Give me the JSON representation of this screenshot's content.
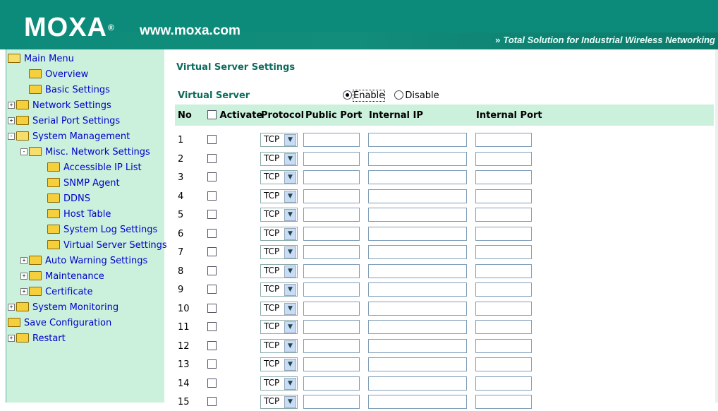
{
  "header": {
    "logo_text": "MOXA",
    "logo_reg": "®",
    "logo_url": "www.moxa.com",
    "tagline_arrow": "»",
    "tagline": "Total Solution for Industrial Wireless Networking",
    "color": "#0d8b7a"
  },
  "sidebar": {
    "items": [
      {
        "label": "Main Menu",
        "expander": "",
        "depth": 0,
        "open": true
      },
      {
        "label": "Overview",
        "expander": "",
        "depth": 1
      },
      {
        "label": "Basic Settings",
        "expander": "",
        "depth": 1
      },
      {
        "label": "Network Settings",
        "expander": "+",
        "depth": 0
      },
      {
        "label": "Serial Port Settings",
        "expander": "+",
        "depth": 0
      },
      {
        "label": "System Management",
        "expander": "-",
        "depth": 0,
        "open": true
      },
      {
        "label": "Misc. Network Settings",
        "expander": "-",
        "depth": 1,
        "open": true
      },
      {
        "label": "Accessible IP List",
        "expander": "",
        "depth": 2
      },
      {
        "label": "SNMP Agent",
        "expander": "",
        "depth": 2
      },
      {
        "label": "DDNS",
        "expander": "",
        "depth": 2
      },
      {
        "label": "Host Table",
        "expander": "",
        "depth": 2
      },
      {
        "label": "System Log Settings",
        "expander": "",
        "depth": 2
      },
      {
        "label": "Virtual Server Settings",
        "expander": "",
        "depth": 2
      },
      {
        "label": "Auto Warning Settings",
        "expander": "+",
        "depth": 1
      },
      {
        "label": "Maintenance",
        "expander": "+",
        "depth": 1
      },
      {
        "label": "Certificate",
        "expander": "+",
        "depth": 1
      },
      {
        "label": "System Monitoring",
        "expander": "+",
        "depth": 0
      },
      {
        "label": "Save Configuration",
        "expander": "",
        "depth": 0
      },
      {
        "label": "Restart",
        "expander": "+",
        "depth": 0
      }
    ],
    "color": "#cbf0dc",
    "link_color": "#0000cc"
  },
  "main": {
    "title": "Virtual Server Settings",
    "virtual_server_label": "Virtual Server",
    "enable_label": "Enable",
    "disable_label": "Disable",
    "enabled": true,
    "headers": {
      "no": "No",
      "activate": "Activate",
      "protocol": "Protocol",
      "public_port": "Public Port",
      "internal_ip": "Internal IP",
      "internal_port": "Internal Port"
    },
    "rows": [
      {
        "no": "1",
        "protocol": "TCP",
        "public_port": "",
        "internal_ip": "",
        "internal_port": ""
      },
      {
        "no": "2",
        "protocol": "TCP",
        "public_port": "",
        "internal_ip": "",
        "internal_port": ""
      },
      {
        "no": "3",
        "protocol": "TCP",
        "public_port": "",
        "internal_ip": "",
        "internal_port": ""
      },
      {
        "no": "4",
        "protocol": "TCP",
        "public_port": "",
        "internal_ip": "",
        "internal_port": ""
      },
      {
        "no": "5",
        "protocol": "TCP",
        "public_port": "",
        "internal_ip": "",
        "internal_port": ""
      },
      {
        "no": "6",
        "protocol": "TCP",
        "public_port": "",
        "internal_ip": "",
        "internal_port": ""
      },
      {
        "no": "7",
        "protocol": "TCP",
        "public_port": "",
        "internal_ip": "",
        "internal_port": ""
      },
      {
        "no": "8",
        "protocol": "TCP",
        "public_port": "",
        "internal_ip": "",
        "internal_port": ""
      },
      {
        "no": "9",
        "protocol": "TCP",
        "public_port": "",
        "internal_ip": "",
        "internal_port": ""
      },
      {
        "no": "10",
        "protocol": "TCP",
        "public_port": "",
        "internal_ip": "",
        "internal_port": ""
      },
      {
        "no": "11",
        "protocol": "TCP",
        "public_port": "",
        "internal_ip": "",
        "internal_port": ""
      },
      {
        "no": "12",
        "protocol": "TCP",
        "public_port": "",
        "internal_ip": "",
        "internal_port": ""
      },
      {
        "no": "13",
        "protocol": "TCP",
        "public_port": "",
        "internal_ip": "",
        "internal_port": ""
      },
      {
        "no": "14",
        "protocol": "TCP",
        "public_port": "",
        "internal_ip": "",
        "internal_port": ""
      },
      {
        "no": "15",
        "protocol": "TCP",
        "public_port": "",
        "internal_ip": "",
        "internal_port": ""
      }
    ],
    "title_color": "#0d6b5d",
    "header_bg": "#cbf0dc"
  }
}
